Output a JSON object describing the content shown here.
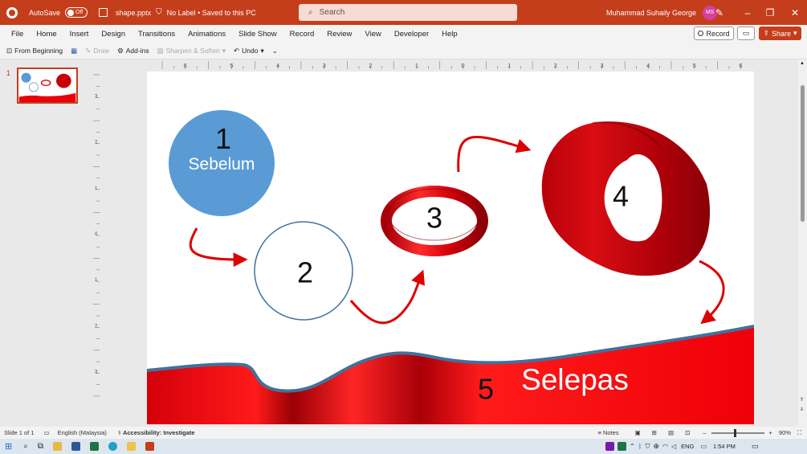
{
  "titlebar": {
    "autosave_label": "AutoSave",
    "autosave_state": "Off",
    "filename": "shape.pptx",
    "label_status": "No Label • Saved to this PC",
    "search_placeholder": "Search",
    "user_name": "Muhammad Suhaily George",
    "user_initials": "MS"
  },
  "menu": [
    "File",
    "Home",
    "Insert",
    "Design",
    "Transitions",
    "Animations",
    "Slide Show",
    "Record",
    "Review",
    "View",
    "Developer",
    "Help"
  ],
  "actions": {
    "record": "Record",
    "share": "Share"
  },
  "toolbar": {
    "from_beginning": "From Beginning",
    "draw": "Draw",
    "addins": "Add-ins",
    "sharpen": "Sharpen & Soften",
    "undo": "Undo"
  },
  "ruler": {
    "h_ticks": [
      "6",
      "5",
      "4",
      "3",
      "2",
      "1",
      "0",
      "1",
      "2",
      "3",
      "4",
      "5",
      "6"
    ],
    "v_ticks": [
      "3",
      "2",
      "1",
      "0",
      "1",
      "2",
      "3"
    ]
  },
  "thumbnail": {
    "number": "1"
  },
  "slide": {
    "circle1_number": "1",
    "circle1_label": "Sebelum",
    "circle2_number": "2",
    "ring3_number": "3",
    "cylinder4_number": "4",
    "ribbon5_number": "5",
    "ribbon5_label": "Selepas"
  },
  "status": {
    "slide_info": "Slide 1 of 1",
    "language": "English (Malaysia)",
    "accessibility": "Accessibility: Investigate",
    "notes": "Notes",
    "zoom": "90%"
  },
  "taskbar": {
    "lang": "ENG",
    "time": "1:54 PM"
  },
  "colors": {
    "brand": "#c43e1c",
    "circle_blue": "#5b9bd5",
    "ribbon_red": "#e8000b",
    "outline_blue": "#41719c"
  }
}
